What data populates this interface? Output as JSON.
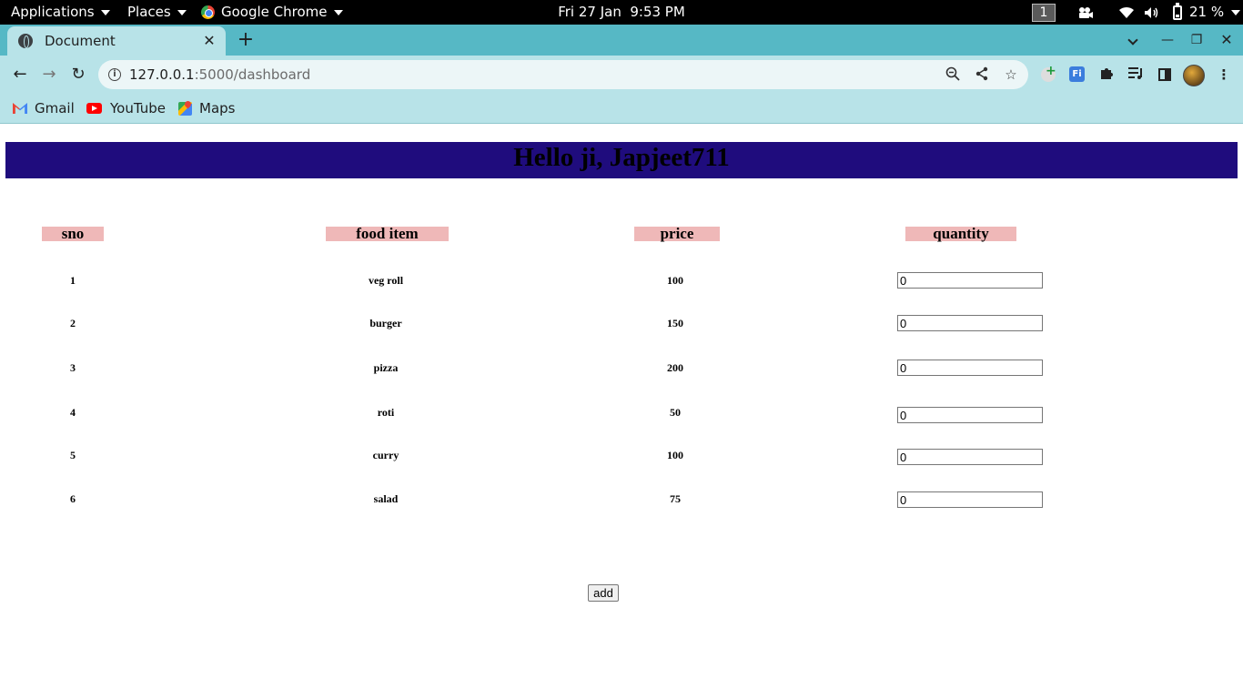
{
  "system_bar": {
    "applications": "Applications",
    "places": "Places",
    "active_app": "Google Chrome",
    "clock": "Fri 27 Jan  9:53 PM",
    "workspace": "1",
    "battery": "21 %"
  },
  "browser": {
    "tab_title": "Document",
    "url_host": "127.0.0.1",
    "url_path": ":5000/dashboard",
    "bookmarks": [
      "Gmail",
      "YouTube",
      "Maps"
    ]
  },
  "page": {
    "greeting": "Hello ji, Japjeet711",
    "columns": [
      "sno",
      "food item",
      "price",
      "quantity"
    ],
    "rows": [
      {
        "sno": "1",
        "item": "veg roll",
        "price": "100",
        "quantity": "0"
      },
      {
        "sno": "2",
        "item": "burger",
        "price": "150",
        "quantity": "0"
      },
      {
        "sno": "3",
        "item": "pizza",
        "price": "200",
        "quantity": "0"
      },
      {
        "sno": "4",
        "item": "roti",
        "price": "50",
        "quantity": "0"
      },
      {
        "sno": "5",
        "item": "curry",
        "price": "100",
        "quantity": "0"
      },
      {
        "sno": "6",
        "item": "salad",
        "price": "75",
        "quantity": "0"
      }
    ],
    "add_label": "add"
  },
  "colors": {
    "banner": "#1f0c7d",
    "header_cell": "#efb8b8",
    "tab_strip": "#56b8c5",
    "toolbar": "#b8e3e8"
  }
}
